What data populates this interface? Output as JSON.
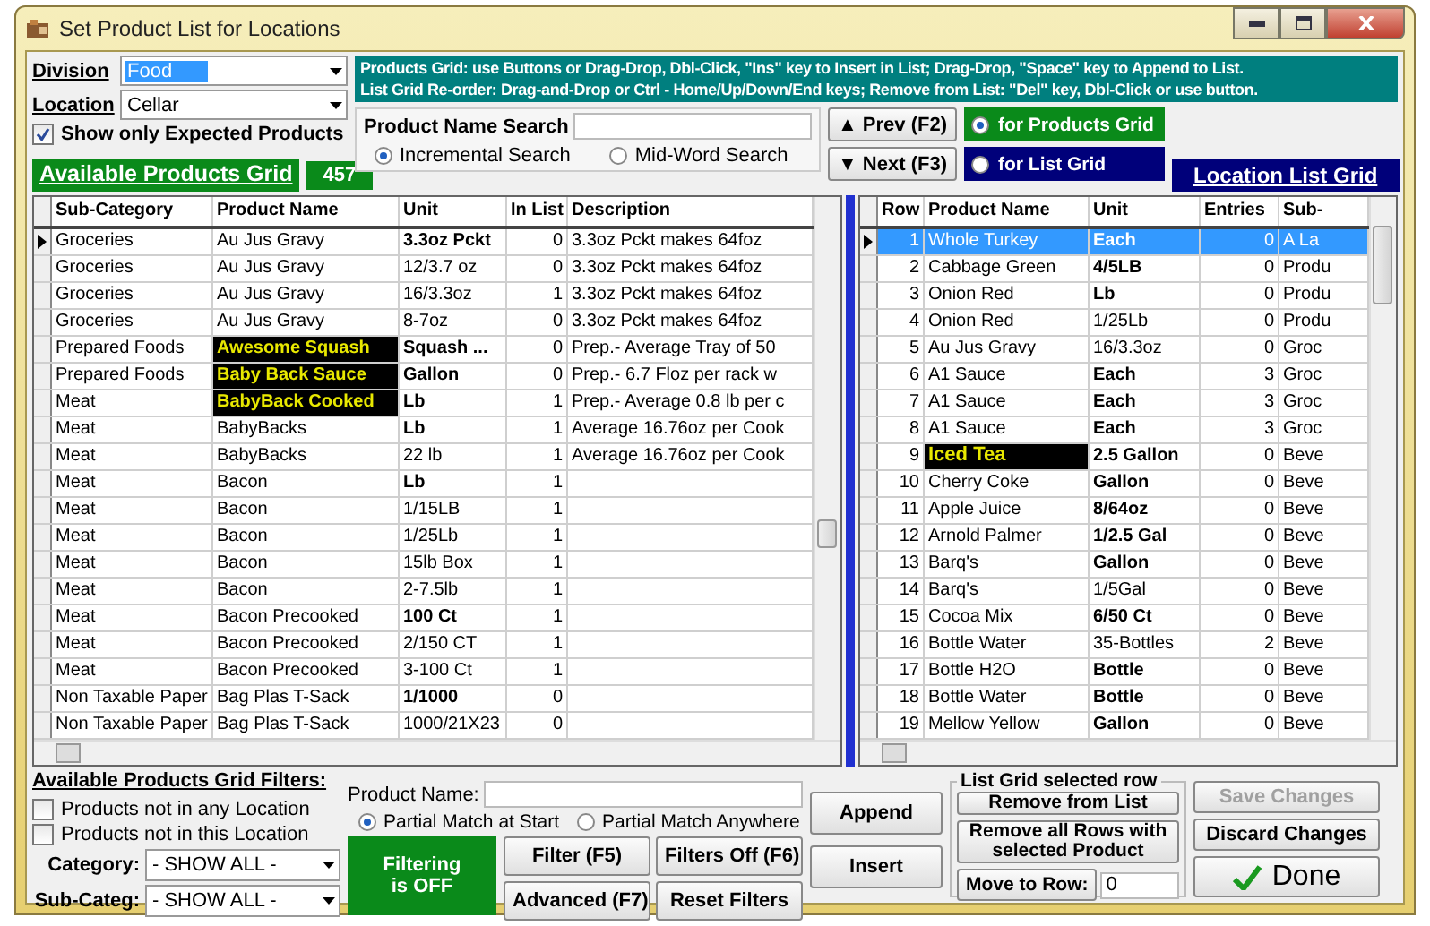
{
  "window": {
    "title": "Set Product List for Locations"
  },
  "division": {
    "label": "Division",
    "value": "Food",
    "focused": true
  },
  "location": {
    "label": "Location",
    "value": "Cellar",
    "focused": false
  },
  "expected_only": {
    "label": "Show only Expected Products",
    "checked": true
  },
  "available_header": {
    "label": "Available Products Grid",
    "count": "457"
  },
  "instructions": [
    "Products Grid: use Buttons or Drag-Drop, Dbl-Click, \"Ins\" key to Insert in List; Drag-Drop, \"Space\" key to Append to List.",
    "List Grid Re-order: Drag-and-Drop or Ctrl - Home/Up/Down/End keys; Remove from List: \"Del\" key, Dbl-Click or use button."
  ],
  "search": {
    "label": "Product Name Search",
    "modes": [
      {
        "label": "Incremental Search",
        "selected": true
      },
      {
        "label": "Mid-Word Search",
        "selected": false
      }
    ],
    "prev": "▲ Prev (F2)",
    "next": "▼ Next (F3)",
    "targets": [
      {
        "label": "for Products Grid",
        "selected": true,
        "color": "#0a8a1a"
      },
      {
        "label": "for List Grid",
        "selected": false,
        "color": "#00007a"
      }
    ]
  },
  "list_header": "Location List Grid",
  "products_grid": {
    "columns": [
      "Sub-Category",
      "Product Name",
      "Unit",
      "In List",
      "Description"
    ],
    "rows": [
      {
        "sub_category": "Groceries",
        "product_name": "Au Jus Gravy",
        "unit": "3.3oz Pckt",
        "in_list": "0",
        "description": "3.3oz Pckt makes 64foz",
        "current": true,
        "highlighted": false,
        "bold_unit": true
      },
      {
        "sub_category": "Groceries",
        "product_name": "Au Jus Gravy",
        "unit": "12/3.7 oz",
        "in_list": "0",
        "description": "3.3oz Pckt makes 64foz",
        "current": false,
        "highlighted": false,
        "bold_unit": false
      },
      {
        "sub_category": "Groceries",
        "product_name": "Au Jus Gravy",
        "unit": "16/3.3oz",
        "in_list": "1",
        "description": "3.3oz Pckt makes 64foz",
        "current": false,
        "highlighted": false,
        "bold_unit": false
      },
      {
        "sub_category": "Groceries",
        "product_name": "Au Jus Gravy",
        "unit": "8-7oz",
        "in_list": "0",
        "description": "3.3oz Pckt makes 64foz",
        "current": false,
        "highlighted": false,
        "bold_unit": false
      },
      {
        "sub_category": "Prepared Foods",
        "product_name": "Awesome Squash",
        "unit": "Squash ...",
        "in_list": "0",
        "description": "Prep.- Average Tray of 50",
        "current": false,
        "highlighted": true,
        "bold_unit": true
      },
      {
        "sub_category": "Prepared Foods",
        "product_name": "Baby Back Sauce",
        "unit": "Gallon",
        "in_list": "0",
        "description": "Prep.- 6.7 Floz per rack w",
        "current": false,
        "highlighted": true,
        "bold_unit": true
      },
      {
        "sub_category": "Meat",
        "product_name": "BabyBack Cooked",
        "unit": "Lb",
        "in_list": "1",
        "description": "Prep.- Average 0.8 lb per c",
        "current": false,
        "highlighted": true,
        "bold_unit": true
      },
      {
        "sub_category": "Meat",
        "product_name": "BabyBacks",
        "unit": "Lb",
        "in_list": "1",
        "description": "Average 16.76oz per Cook",
        "current": false,
        "highlighted": false,
        "bold_unit": true
      },
      {
        "sub_category": "Meat",
        "product_name": "BabyBacks",
        "unit": "22 lb",
        "in_list": "1",
        "description": "Average 16.76oz per Cook",
        "current": false,
        "highlighted": false,
        "bold_unit": false
      },
      {
        "sub_category": "Meat",
        "product_name": "Bacon",
        "unit": "Lb",
        "in_list": "1",
        "current": false,
        "highlighted": false,
        "bold_unit": true
      },
      {
        "sub_category": "Meat",
        "product_name": "Bacon",
        "unit": "1/15LB",
        "in_list": "1",
        "current": false,
        "highlighted": false,
        "bold_unit": false
      },
      {
        "sub_category": "Meat",
        "product_name": "Bacon",
        "unit": "1/25Lb",
        "in_list": "1",
        "current": false,
        "highlighted": false,
        "bold_unit": false
      },
      {
        "sub_category": "Meat",
        "product_name": "Bacon",
        "unit": "15lb Box",
        "in_list": "1",
        "current": false,
        "highlighted": false,
        "bold_unit": false
      },
      {
        "sub_category": "Meat",
        "product_name": "Bacon",
        "unit": "2-7.5lb",
        "in_list": "1",
        "current": false,
        "highlighted": false,
        "bold_unit": false
      },
      {
        "sub_category": "Meat",
        "product_name": "Bacon Precooked",
        "unit": "100 Ct",
        "in_list": "1",
        "current": false,
        "highlighted": false,
        "bold_unit": true
      },
      {
        "sub_category": "Meat",
        "product_name": "Bacon Precooked",
        "unit": "2/150 CT",
        "in_list": "1",
        "current": false,
        "highlighted": false,
        "bold_unit": false
      },
      {
        "sub_category": "Meat",
        "product_name": "Bacon Precooked",
        "unit": "3-100 Ct",
        "in_list": "1",
        "current": false,
        "highlighted": false,
        "bold_unit": false
      },
      {
        "sub_category": "Non Taxable Paper",
        "product_name": "Bag Plas T-Sack",
        "unit": "1/1000",
        "in_list": "0",
        "current": false,
        "highlighted": false,
        "bold_unit": true
      },
      {
        "sub_category": "Non Taxable Paper",
        "product_name": "Bag Plas T-Sack",
        "unit": "1000/21X23",
        "in_list": "0",
        "current": false,
        "highlighted": false,
        "bold_unit": false
      }
    ]
  },
  "list_grid": {
    "columns": [
      "Row",
      "Product Name",
      "Unit",
      "Entries",
      "Sub-"
    ],
    "rows": [
      {
        "row": "1",
        "product_name": "Whole Turkey",
        "unit": "Each",
        "entries": "0",
        "sub": "A La",
        "current": true,
        "selected": true,
        "highlighted": false,
        "bold_unit": true
      },
      {
        "row": "2",
        "product_name": "Cabbage Green",
        "unit": "4/5LB",
        "entries": "0",
        "sub": "Produ",
        "current": false,
        "selected": false,
        "highlighted": false,
        "bold_unit": true
      },
      {
        "row": "3",
        "product_name": "Onion Red",
        "unit": "Lb",
        "entries": "0",
        "sub": "Produ",
        "current": false,
        "selected": false,
        "highlighted": false,
        "bold_unit": true
      },
      {
        "row": "4",
        "product_name": "Onion Red",
        "unit": "1/25Lb",
        "entries": "0",
        "sub": "Produ",
        "current": false,
        "selected": false,
        "highlighted": false,
        "bold_unit": false
      },
      {
        "row": "5",
        "product_name": "Au Jus Gravy",
        "unit": "16/3.3oz",
        "entries": "0",
        "sub": "Groc",
        "current": false,
        "selected": false,
        "highlighted": false,
        "bold_unit": false
      },
      {
        "row": "6",
        "product_name": "A1 Sauce",
        "unit": "Each",
        "entries": "3",
        "sub": "Groc",
        "current": false,
        "selected": false,
        "highlighted": false,
        "bold_unit": true
      },
      {
        "row": "7",
        "product_name": "A1 Sauce",
        "unit": "Each",
        "entries": "3",
        "sub": "Groc",
        "current": false,
        "selected": false,
        "highlighted": false,
        "bold_unit": true
      },
      {
        "row": "8",
        "product_name": "A1 Sauce",
        "unit": "Each",
        "entries": "3",
        "sub": "Groc",
        "current": false,
        "selected": false,
        "highlighted": false,
        "bold_unit": true
      },
      {
        "row": "9",
        "product_name": "Iced Tea",
        "unit": "2.5 Gallon",
        "entries": "0",
        "sub": "Beve",
        "current": false,
        "selected": false,
        "highlighted": true,
        "bold_unit": true
      },
      {
        "row": "10",
        "product_name": "Cherry Coke",
        "unit": "Gallon",
        "entries": "0",
        "sub": "Beve",
        "current": false,
        "selected": false,
        "highlighted": false,
        "bold_unit": true
      },
      {
        "row": "11",
        "product_name": "Apple Juice",
        "unit": "8/64oz",
        "entries": "0",
        "sub": "Beve",
        "current": false,
        "selected": false,
        "highlighted": false,
        "bold_unit": true
      },
      {
        "row": "12",
        "product_name": "Arnold Palmer",
        "unit": "1/2.5 Gal",
        "entries": "0",
        "sub": "Beve",
        "current": false,
        "selected": false,
        "highlighted": false,
        "bold_unit": true
      },
      {
        "row": "13",
        "product_name": "Barq's",
        "unit": "Gallon",
        "entries": "0",
        "sub": "Beve",
        "current": false,
        "selected": false,
        "highlighted": false,
        "bold_unit": true
      },
      {
        "row": "14",
        "product_name": "Barq's",
        "unit": "1/5Gal",
        "entries": "0",
        "sub": "Beve",
        "current": false,
        "selected": false,
        "highlighted": false,
        "bold_unit": false
      },
      {
        "row": "15",
        "product_name": "Cocoa Mix",
        "unit": "6/50 Ct",
        "entries": "0",
        "sub": "Beve",
        "current": false,
        "selected": false,
        "highlighted": false,
        "bold_unit": true
      },
      {
        "row": "16",
        "product_name": "Bottle Water",
        "unit": "35-Bottles",
        "entries": "2",
        "sub": "Beve",
        "current": false,
        "selected": false,
        "highlighted": false,
        "bold_unit": false
      },
      {
        "row": "17",
        "product_name": "Bottle H2O",
        "unit": "Bottle",
        "entries": "0",
        "sub": "Beve",
        "current": false,
        "selected": false,
        "highlighted": false,
        "bold_unit": true
      },
      {
        "row": "18",
        "product_name": "Bottle Water",
        "unit": "Bottle",
        "entries": "0",
        "sub": "Beve",
        "current": false,
        "selected": false,
        "highlighted": false,
        "bold_unit": true
      },
      {
        "row": "19",
        "product_name": "Mellow Yellow",
        "unit": "Gallon",
        "entries": "0",
        "sub": "Beve",
        "current": false,
        "selected": false,
        "highlighted": false,
        "bold_unit": true
      }
    ]
  },
  "filters": {
    "title": "Available Products Grid Filters:",
    "checks": [
      {
        "label": "Products not in any Location",
        "checked": false
      },
      {
        "label": "Products not in this Location",
        "checked": false
      }
    ],
    "selects": [
      {
        "label": "Category:",
        "value": "- SHOW ALL -"
      },
      {
        "label": "Sub-Categ:",
        "value": "- SHOW ALL -"
      }
    ],
    "name_label": "Product Name:",
    "match_modes": [
      {
        "label": "Partial Match at Start",
        "selected": true
      },
      {
        "label": "Partial Match Anywhere",
        "selected": false
      }
    ],
    "status": "Filtering\nis OFF",
    "buttons": [
      "Filter (F5)",
      "Filters Off (F6)",
      "Advanced (F7)",
      "Reset Filters"
    ]
  },
  "list_buttons": [
    "Append",
    "Insert"
  ],
  "row_group": {
    "title": "List Grid selected row",
    "buttons": [
      "Remove from List",
      "Remove all Rows with selected Product"
    ],
    "move_label": "Move to Row:",
    "move_value": "0"
  },
  "actions": [
    {
      "label": "Save Changes",
      "disabled": true,
      "kind": "plain"
    },
    {
      "label": "Discard Changes",
      "disabled": false,
      "kind": "plain"
    },
    {
      "label": "Done",
      "disabled": false,
      "kind": "done"
    }
  ]
}
